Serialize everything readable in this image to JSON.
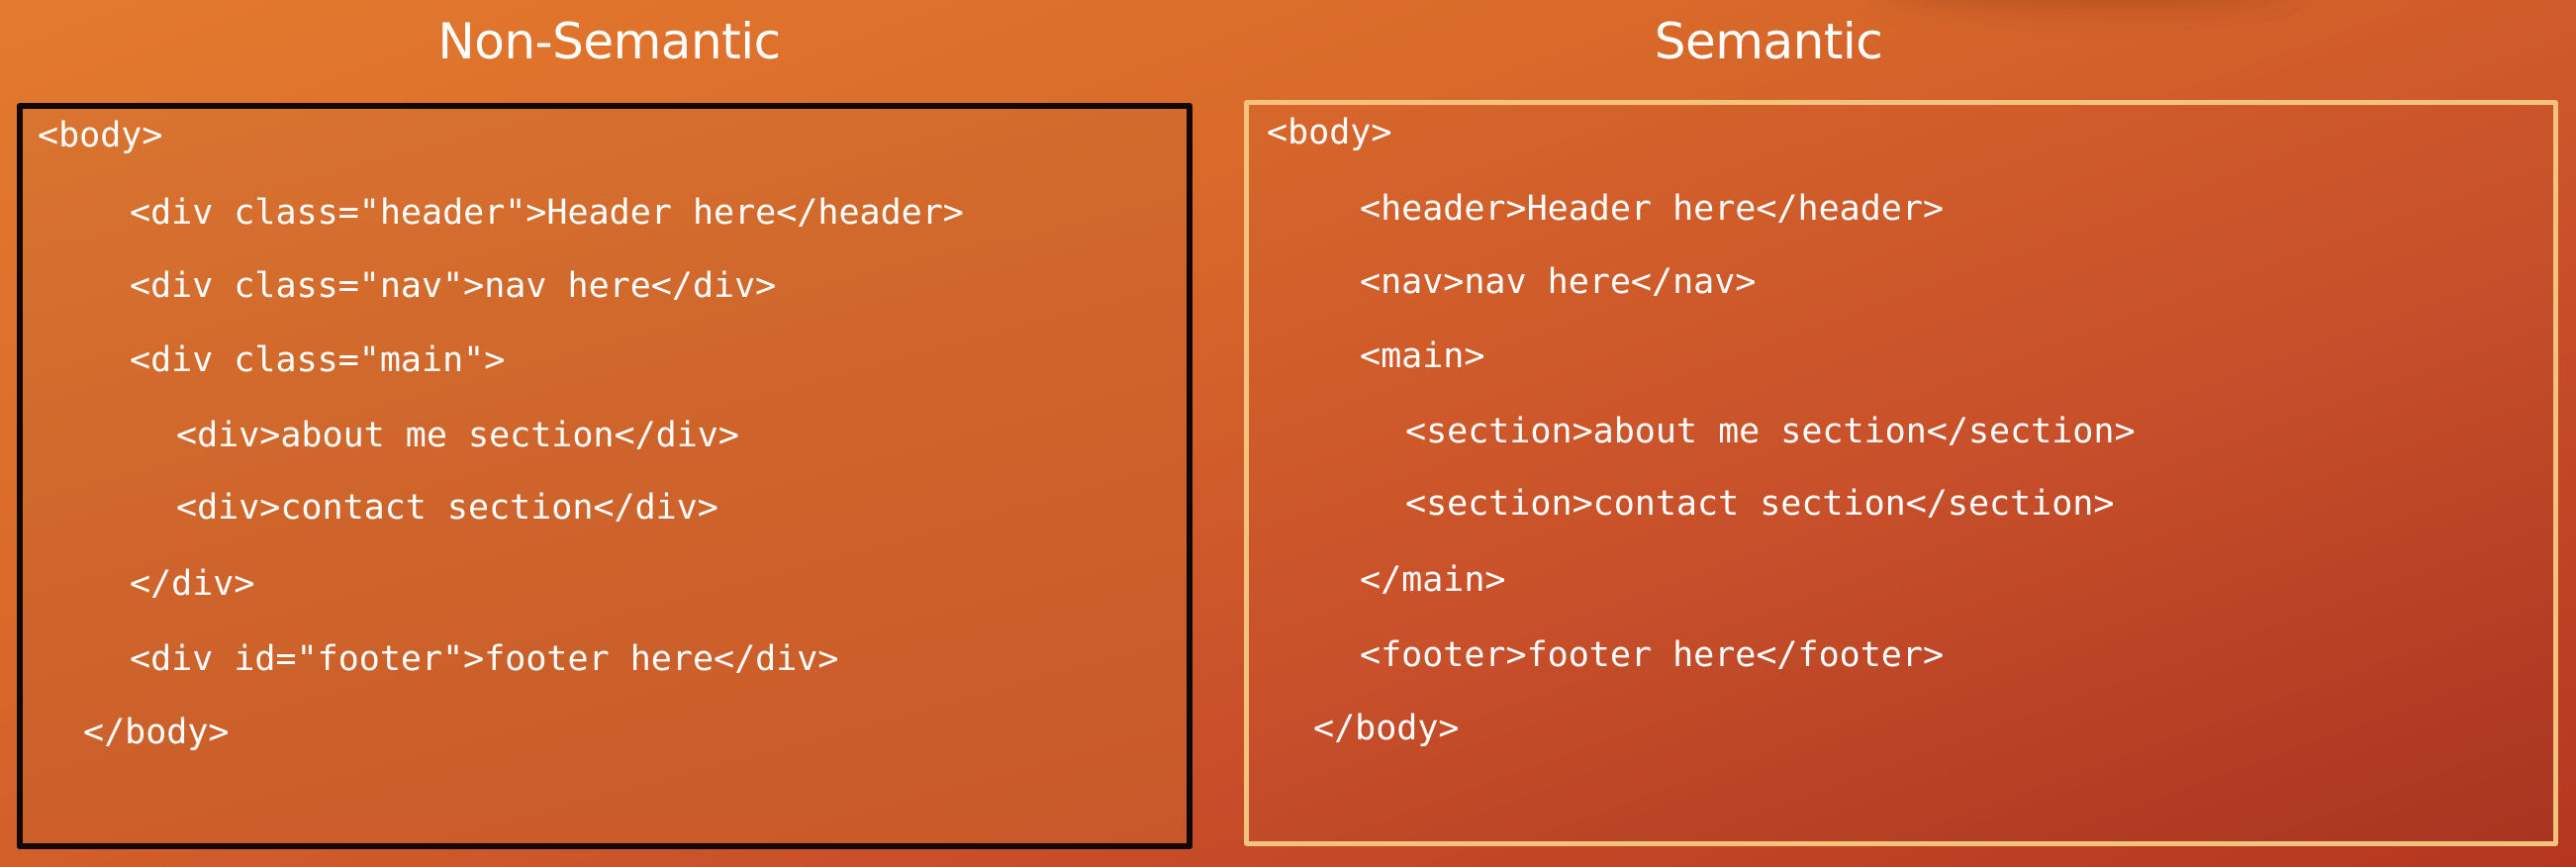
{
  "headings": {
    "left": "Non-Semantic",
    "right": "Semantic"
  },
  "non_semantic": {
    "lines": [
      "<body>",
      "<div class=\"header\">Header here</header>",
      "<div class=\"nav\">nav here</div>",
      "<div class=\"main\">",
      "<div>about me section</div>",
      "<div>contact section</div>",
      "</div>",
      "<div id=\"footer\">footer here</div>",
      "</body>"
    ]
  },
  "semantic": {
    "lines": [
      "<body>",
      "<header>Header here</header>",
      "<nav>nav here</nav>",
      "<main>",
      "<section>about me section</section>",
      "<section>contact section</section>",
      "</main>",
      "<footer>footer here</footer>",
      "</body>"
    ]
  },
  "colors": {
    "background": "#d9692a",
    "left_border": "#120906",
    "right_border": "#f3c27c",
    "text": "#ffffff"
  }
}
